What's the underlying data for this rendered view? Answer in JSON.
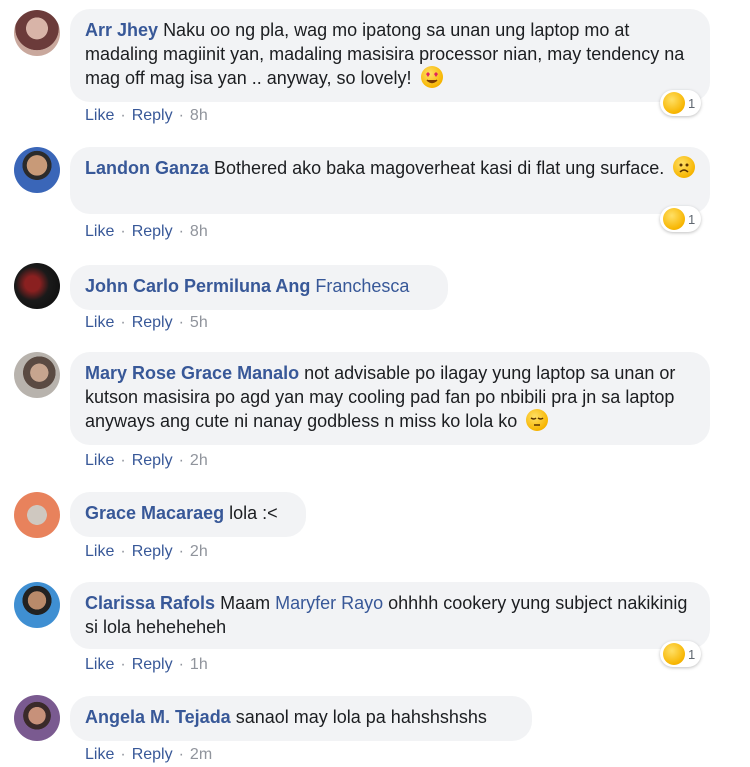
{
  "comments": [
    {
      "author": "Arr Jhey",
      "text": "Naku oo ng pla, wag mo ipatong sa unan ung laptop mo at madaling magiinit yan, madaling masisira processor nian, may tendency na mag off mag isa yan .. anyway, so lovely!",
      "emoji": "heart-eyes-emoji",
      "like": "Like",
      "reply": "Reply",
      "time": "8h",
      "reaction_icon": "haha-reaction-icon",
      "reaction_count": "1"
    },
    {
      "author": "Landon Ganza",
      "text": "Bothered ako baka magoverheat kasi di flat ung surface.",
      "emoji": "frown-emoji",
      "like": "Like",
      "reply": "Reply",
      "time": "8h",
      "reaction_icon": "sad-reaction-icon",
      "reaction_count": "1"
    },
    {
      "author": "John Carlo Permiluna Ang",
      "mention": "Franchesca",
      "like": "Like",
      "reply": "Reply",
      "time": "5h"
    },
    {
      "author": "Mary Rose Grace Manalo",
      "text": "not advisable po ilagay yung laptop sa unan or kutson masisira po agd yan may cooling pad fan po nbibili pra jn sa laptop anyways ang cute ni nanay godbless n miss ko lola ko",
      "emoji": "pensive-emoji",
      "like": "Like",
      "reply": "Reply",
      "time": "2h"
    },
    {
      "author": "Grace Macaraeg",
      "text": "lola :<",
      "like": "Like",
      "reply": "Reply",
      "time": "2h"
    },
    {
      "author": "Clarissa Rafols",
      "text_before": "Maam",
      "mention": "Maryfer Rayo",
      "text": "ohhhh cookery yung subject nakikinig si lola heheheheh",
      "like": "Like",
      "reply": "Reply",
      "time": "1h",
      "reaction_icon": "haha-reaction-icon",
      "reaction_count": "1"
    },
    {
      "author": "Angela M. Tejada",
      "text": "sanaol may lola pa hahshshshs",
      "like": "Like",
      "reply": "Reply",
      "time": "2m"
    }
  ],
  "colors": {
    "name_link": "#385898",
    "bubble_bg": "#f2f3f5",
    "meta_gray": "#90949c"
  }
}
